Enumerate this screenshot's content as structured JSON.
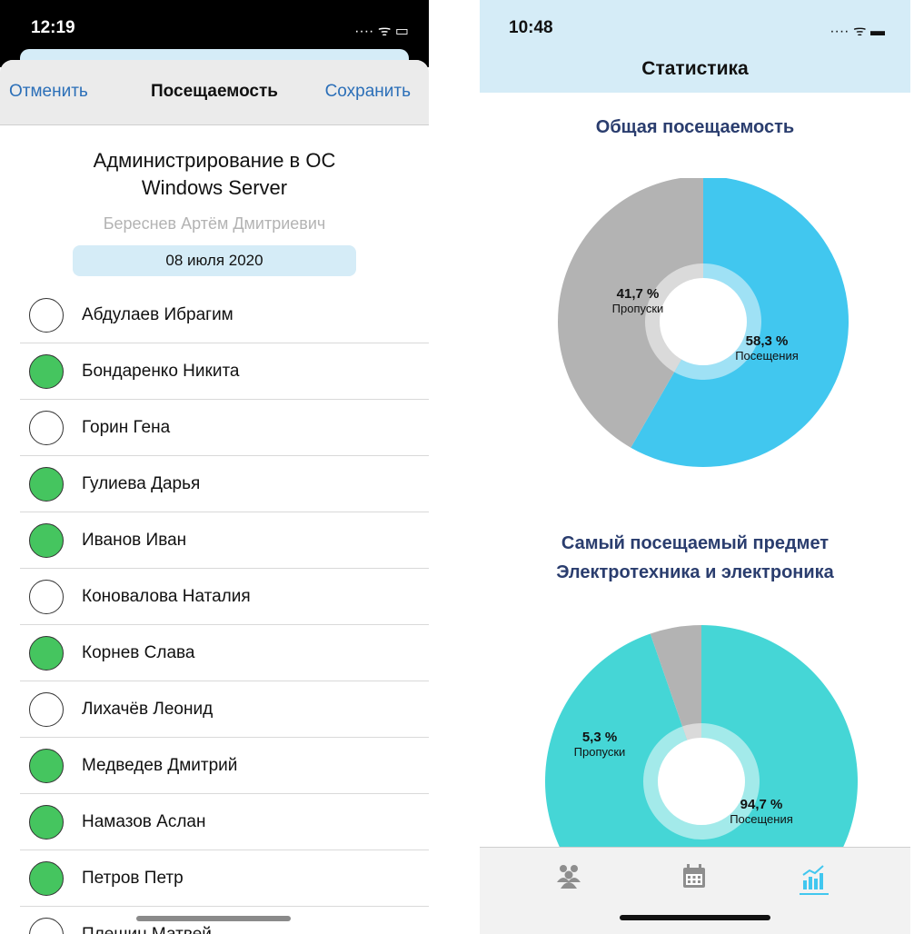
{
  "left": {
    "status": {
      "time": "12:19",
      "icons": "···· ᯤ ▭"
    },
    "navbar": {
      "cancel": "Отменить",
      "title": "Посещаемость",
      "save": "Сохранить"
    },
    "subject": "Администрирование в ОС Windows Server",
    "teacher": "Береснев Артём Дмитриевич",
    "date": "08 июля 2020",
    "students": [
      {
        "name": "Абдулаев Ибрагим",
        "present": false
      },
      {
        "name": "Бондаренко Никита",
        "present": true
      },
      {
        "name": "Горин Гена",
        "present": false
      },
      {
        "name": "Гулиева Дарья",
        "present": true
      },
      {
        "name": "Иванов Иван",
        "present": true
      },
      {
        "name": "Коновалова Наталия",
        "present": false
      },
      {
        "name": "Корнев Слава",
        "present": true
      },
      {
        "name": "Лихачёв  Леонид",
        "present": false
      },
      {
        "name": "Медведев Дмитрий",
        "present": true
      },
      {
        "name": "Намазов Аслан",
        "present": true
      },
      {
        "name": "Петров Петр",
        "present": true
      },
      {
        "name": "Плешин Матвей",
        "present": false
      }
    ]
  },
  "right": {
    "status": {
      "time": "10:48",
      "icons": "···· ᯤ ▬"
    },
    "title": "Статистика",
    "chart1_title": "Общая посещаемость",
    "chart2_title_line1": "Самый посещаемый предмет",
    "chart2_title_line2": "Электротехника и электроника",
    "tabs": [
      "users-tab",
      "calendar-tab",
      "statistics-tab"
    ],
    "active_tab": "statistics-tab"
  },
  "chart_data": [
    {
      "type": "pie",
      "title": "Общая посещаемость",
      "categories": [
        "Посещения",
        "Пропуски"
      ],
      "values": [
        58.3,
        41.7
      ],
      "value_labels": [
        "58,3 %",
        "41,7 %"
      ],
      "colors": [
        "#41c7ef",
        "#b3b3b3"
      ],
      "inner_ring_colors": [
        "#9fe1f5",
        "#dadada"
      ]
    },
    {
      "type": "pie",
      "title": "Самый посещаемый предмет Электротехника и электроника",
      "categories": [
        "Посещения",
        "Пропуски"
      ],
      "values": [
        94.7,
        5.3
      ],
      "value_labels": [
        "94,7 %",
        "5,3 %"
      ],
      "colors": [
        "#45d6d6",
        "#b3b3b3"
      ],
      "inner_ring_colors": [
        "#a3eaea",
        "#dadada"
      ]
    }
  ]
}
